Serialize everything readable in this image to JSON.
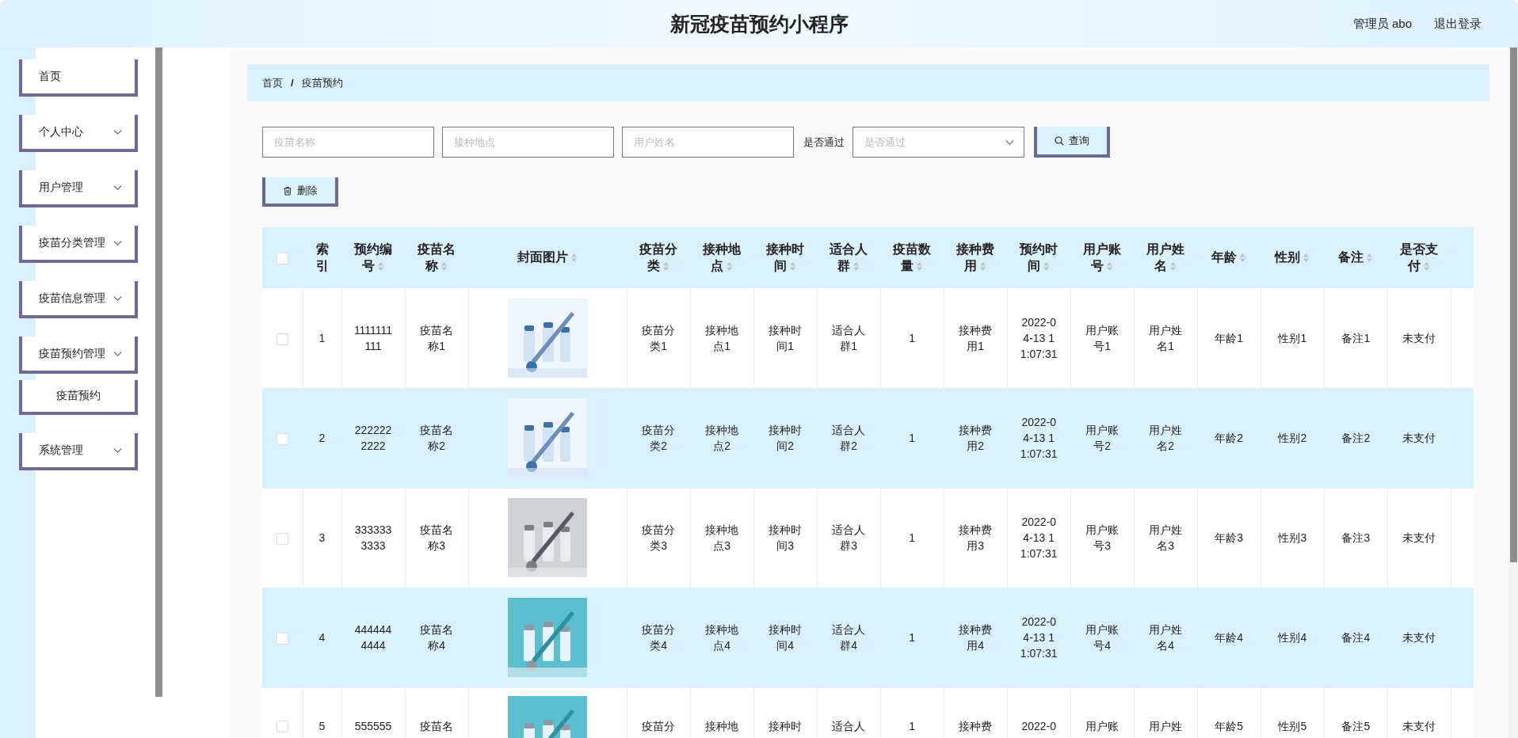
{
  "header": {
    "title": "新冠疫苗预约小程序",
    "user": "管理员 abo",
    "logout": "退出登录"
  },
  "sidebar": {
    "items": [
      {
        "label": "首页",
        "expandable": false
      },
      {
        "label": "个人中心",
        "expandable": true
      },
      {
        "label": "用户管理",
        "expandable": true
      },
      {
        "label": "疫苗分类管理",
        "expandable": true
      },
      {
        "label": "疫苗信息管理",
        "expandable": true
      },
      {
        "label": "疫苗预约管理",
        "expandable": true,
        "children": [
          {
            "label": "疫苗预约"
          }
        ]
      },
      {
        "label": "系统管理",
        "expandable": true
      }
    ]
  },
  "breadcrumb": {
    "items": [
      "首页",
      "疫苗预约"
    ],
    "separator": "/"
  },
  "search": {
    "fields": [
      {
        "placeholder": "疫苗名称"
      },
      {
        "placeholder": "接种地点"
      },
      {
        "placeholder": "用户姓名"
      }
    ],
    "filter_label": "是否通过",
    "filter_placeholder": "是否通过",
    "button": "查询"
  },
  "delete_button": "删除",
  "table": {
    "select_all": {
      "checked": false
    },
    "columns": [
      {
        "label": "索引",
        "kind": "text",
        "sortable": false
      },
      {
        "label": "预约编号",
        "kind": "text",
        "sortable": true
      },
      {
        "label": "疫苗名称",
        "kind": "text",
        "sortable": true
      },
      {
        "label": "封面图片",
        "kind": "picture",
        "sortable": true
      },
      {
        "label": "疫苗分类",
        "kind": "text",
        "sortable": true
      },
      {
        "label": "接种地点",
        "kind": "text",
        "sortable": true
      },
      {
        "label": "接种时间",
        "kind": "text",
        "sortable": true
      },
      {
        "label": "适合人群",
        "kind": "text",
        "sortable": true
      },
      {
        "label": "疫苗数量",
        "kind": "text",
        "sortable": true
      },
      {
        "label": "接种费用",
        "kind": "text",
        "sortable": true
      },
      {
        "label": "预约时间",
        "kind": "text",
        "sortable": true
      },
      {
        "label": "用户账号",
        "kind": "text",
        "sortable": true
      },
      {
        "label": "用户姓名",
        "kind": "text",
        "sortable": true
      },
      {
        "label": "年龄",
        "kind": "text",
        "sortable": true
      },
      {
        "label": "性别",
        "kind": "text",
        "sortable": true
      },
      {
        "label": "备注",
        "kind": "text",
        "sortable": true
      },
      {
        "label": "是否支付",
        "kind": "text",
        "sortable": true
      }
    ],
    "rows": [
      {
        "checked": false,
        "cells": [
          "1",
          "1111111111",
          "疫苗名称1",
          {
            "kind": "picture"
          },
          "疫苗分类1",
          "接种地点1",
          "接种时间1",
          "适合人群1",
          "1",
          "接种费用1",
          "2022-04-13 11:07:31",
          "用户账号1",
          "用户姓名1",
          "年龄1",
          "性别1",
          "备注1",
          "未支付"
        ]
      },
      {
        "checked": false,
        "cells": [
          "2",
          "2222222222",
          "疫苗名称2",
          {
            "kind": "picture"
          },
          "疫苗分类2",
          "接种地点2",
          "接种时间2",
          "适合人群2",
          "1",
          "接种费用2",
          "2022-04-13 11:07:31",
          "用户账号2",
          "用户姓名2",
          "年龄2",
          "性别2",
          "备注2",
          "未支付"
        ]
      },
      {
        "checked": false,
        "cells": [
          "3",
          "3333333333",
          "疫苗名称3",
          {
            "kind": "picture"
          },
          "疫苗分类3",
          "接种地点3",
          "接种时间3",
          "适合人群3",
          "1",
          "接种费用3",
          "2022-04-13 11:07:31",
          "用户账号3",
          "用户姓名3",
          "年龄3",
          "性别3",
          "备注3",
          "未支付"
        ]
      },
      {
        "checked": false,
        "cells": [
          "4",
          "4444444444",
          "疫苗名称4",
          {
            "kind": "picture"
          },
          "疫苗分类4",
          "接种地点4",
          "接种时间4",
          "适合人群4",
          "1",
          "接种费用4",
          "2022-04-13 11:07:31",
          "用户账号4",
          "用户姓名4",
          "年龄4",
          "性别4",
          "备注4",
          "未支付"
        ]
      },
      {
        "checked": false,
        "cells": [
          "5",
          "555555",
          "疫苗名",
          {
            "kind": "picture"
          },
          "疫苗分",
          "接种地",
          "接种时",
          "适合人",
          "1",
          "接种费",
          "2022-0",
          "用户账",
          "用户姓",
          "年龄5",
          "性别5",
          "备注5",
          "未支付"
        ]
      }
    ]
  }
}
